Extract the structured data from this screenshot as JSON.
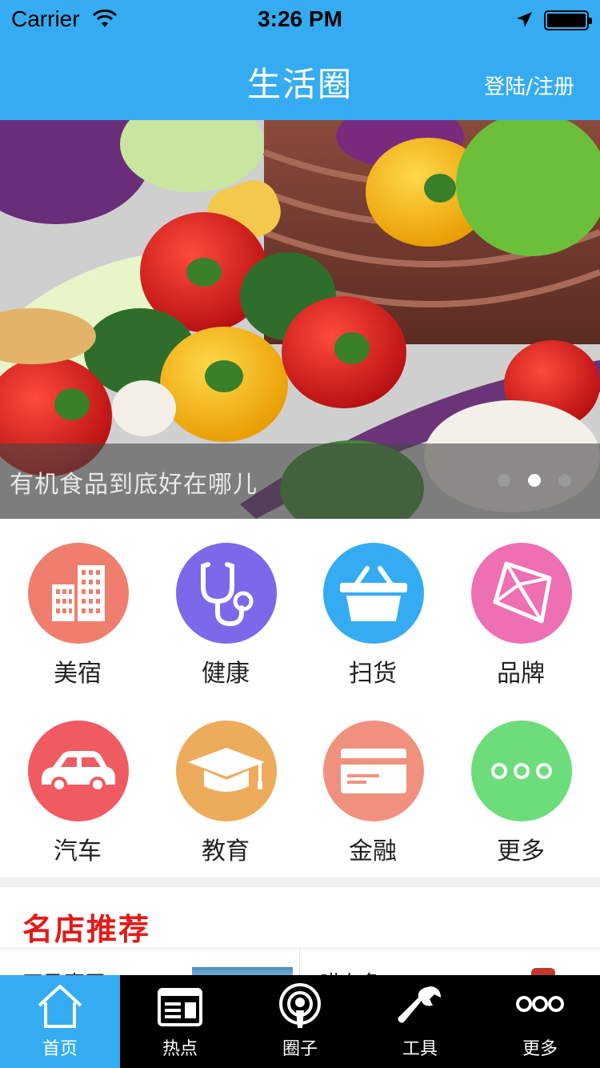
{
  "status_bar": {
    "carrier": "Carrier",
    "time": "3:26 PM"
  },
  "nav": {
    "title": "生活圈",
    "login": "登陆/注册"
  },
  "banner": {
    "caption": "有机食品到底好在哪儿",
    "page_count": 3,
    "active_page": 1
  },
  "categories": [
    {
      "label": "美宿",
      "icon": "buildings-icon",
      "color": "#f07e6e"
    },
    {
      "label": "健康",
      "icon": "stethoscope-icon",
      "color": "#7c69ea"
    },
    {
      "label": "扫货",
      "icon": "basket-icon",
      "color": "#35acf1"
    },
    {
      "label": "品牌",
      "icon": "diamond-icon",
      "color": "#ef6fb3"
    },
    {
      "label": "汽车",
      "icon": "car-icon",
      "color": "#ef5b61"
    },
    {
      "label": "教育",
      "icon": "graduation-cap-icon",
      "color": "#edac5c"
    },
    {
      "label": "金融",
      "icon": "card-icon",
      "color": "#f0917f"
    },
    {
      "label": "更多",
      "icon": "more-dots-icon",
      "color": "#6ddc7b"
    }
  ],
  "recommend": {
    "title": "名店推荐",
    "shops": [
      {
        "name": "四马事王"
      },
      {
        "name": "喵有鱼"
      }
    ]
  },
  "tabbar": [
    {
      "label": "首页",
      "icon": "home-icon",
      "active": true
    },
    {
      "label": "热点",
      "icon": "news-icon",
      "active": false
    },
    {
      "label": "圈子",
      "icon": "podcast-icon",
      "active": false
    },
    {
      "label": "工具",
      "icon": "wrench-icon",
      "active": false
    },
    {
      "label": "更多",
      "icon": "more-dots-icon",
      "active": false
    }
  ]
}
